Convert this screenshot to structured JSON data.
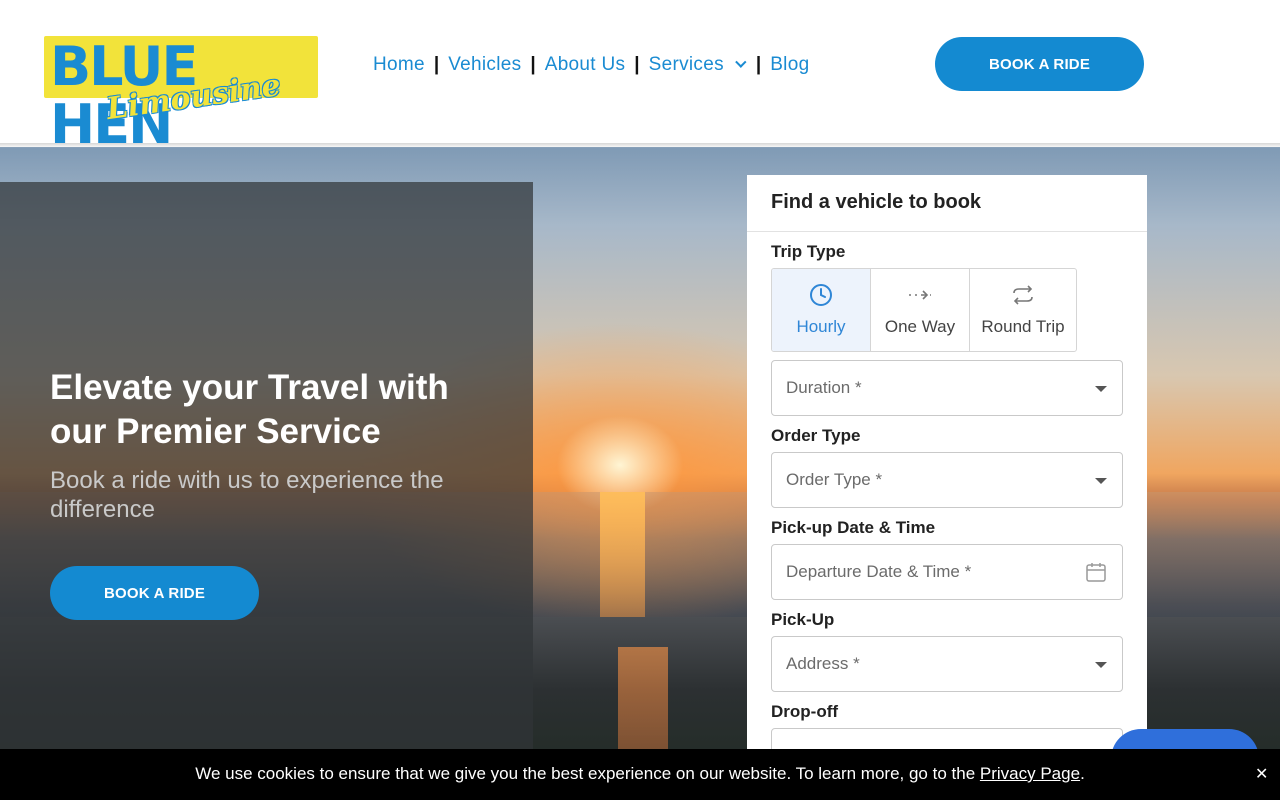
{
  "brand": {
    "logo_main": "BLUE HEN",
    "logo_script": "Limousine",
    "colors": {
      "accent": "#148ad1",
      "logo_yellow": "#f2e33a",
      "nav_link": "#1a8bd2"
    }
  },
  "nav": {
    "items": [
      {
        "label": "Home"
      },
      {
        "label": "Vehicles"
      },
      {
        "label": "About Us"
      },
      {
        "label": "Services",
        "has_dropdown": true
      },
      {
        "label": "Blog"
      }
    ],
    "separator": "|",
    "cta": "BOOK A RIDE"
  },
  "hero": {
    "title": "Elevate your Travel with our Premier Service",
    "subtitle": "Book a ride with us to experience the difference",
    "cta": "BOOK A RIDE"
  },
  "booking_form": {
    "title": "Find a vehicle to book",
    "trip_type_label": "Trip Type",
    "trip_types": [
      {
        "label": "Hourly",
        "icon": "clock-icon",
        "active": true
      },
      {
        "label": "One Way",
        "icon": "one-way-arrow-icon",
        "active": false
      },
      {
        "label": "Round Trip",
        "icon": "round-trip-icon",
        "active": false
      }
    ],
    "duration_placeholder": "Duration *",
    "order_type_label": "Order Type",
    "order_type_placeholder": "Order Type *",
    "pickup_datetime_label": "Pick-up Date & Time",
    "pickup_datetime_placeholder": "Departure Date & Time *",
    "pickup_label": "Pick-Up",
    "pickup_placeholder": "Address *",
    "dropoff_label": "Drop-off"
  },
  "cookie_banner": {
    "text": "We use cookies to ensure that we give you the best experience on our website. To learn more, go to the",
    "link": "Privacy Page",
    "suffix": ".",
    "close": "✕"
  }
}
